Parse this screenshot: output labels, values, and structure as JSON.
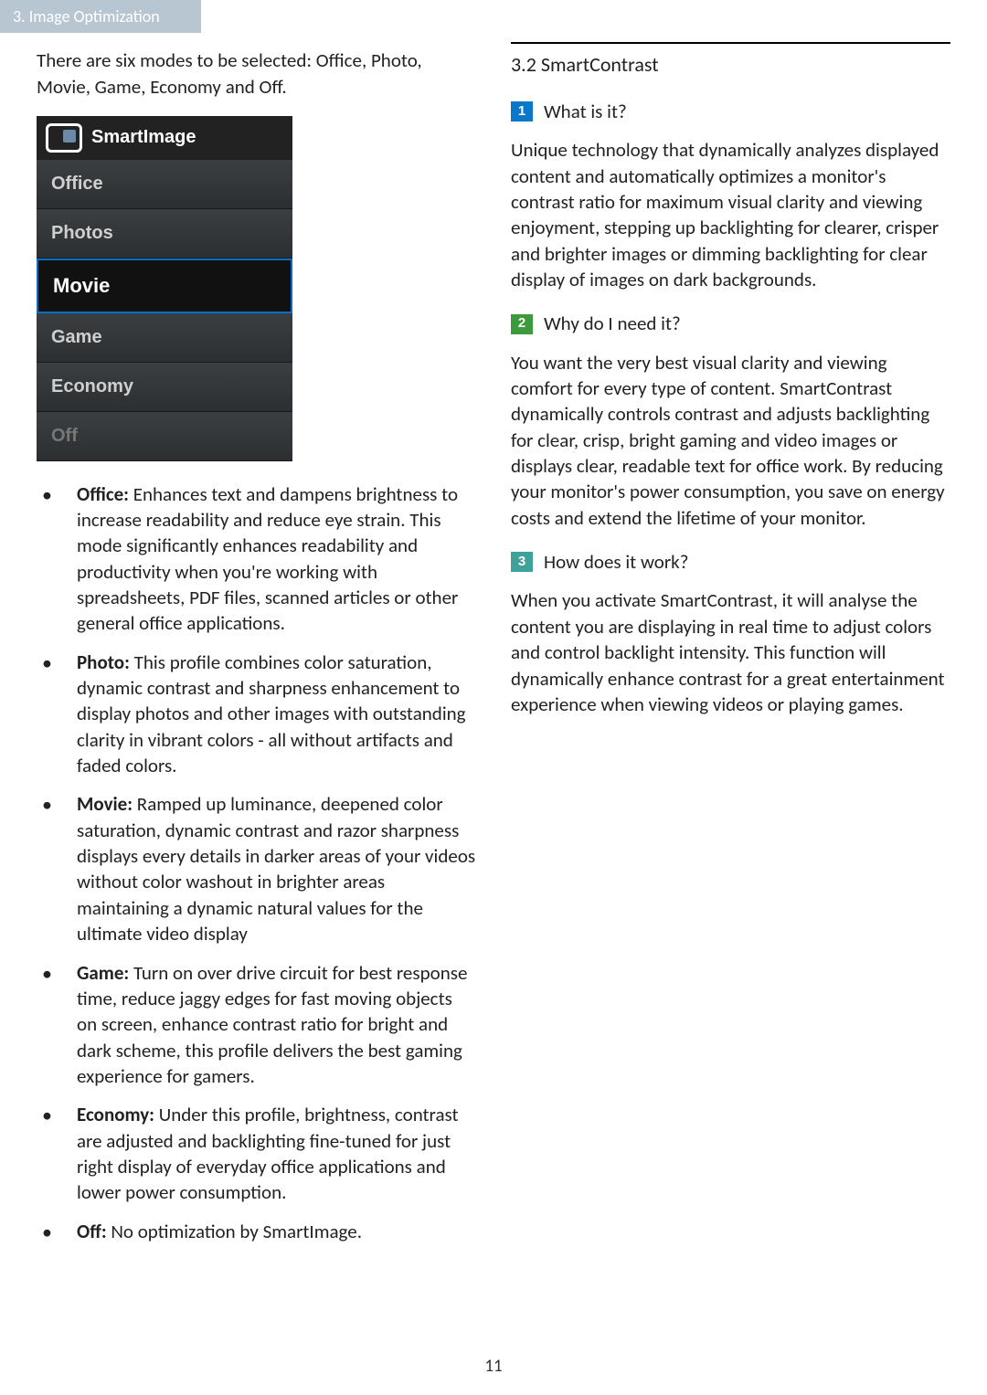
{
  "header": {
    "breadcrumb": "3. Image Optimization"
  },
  "left": {
    "intro": "There are six modes to be selected: Office, Photo, Movie, Game, Economy and Off.",
    "osd": {
      "title": "SmartImage",
      "items": [
        {
          "label": "Office",
          "selected": false,
          "dim": false
        },
        {
          "label": "Photos",
          "selected": false,
          "dim": false
        },
        {
          "label": "Movie",
          "selected": true,
          "dim": false
        },
        {
          "label": "Game",
          "selected": false,
          "dim": false
        },
        {
          "label": "Economy",
          "selected": false,
          "dim": false
        },
        {
          "label": "Off",
          "selected": false,
          "dim": true
        }
      ]
    },
    "modes": [
      {
        "term": "Office:",
        "desc": " Enhances text and dampens brightness to increase readability and reduce eye strain. This mode significantly enhances readability and productivity when you're working with spreadsheets, PDF files, scanned articles or other general office applications."
      },
      {
        "term": "Photo:",
        "desc": " This profile combines color saturation, dynamic contrast and sharpness enhancement to display photos and other images with outstanding clarity in vibrant colors - all without artifacts and faded colors."
      },
      {
        "term": "Movie:",
        "desc": " Ramped up luminance, deepened color saturation, dynamic contrast and razor sharpness displays every details in darker areas of your videos without color washout in brighter areas maintaining a dynamic natural values for the ultimate video display"
      },
      {
        "term": "Game:",
        "desc": " Turn on over drive circuit for best response time, reduce jaggy edges for fast moving objects on screen, enhance contrast ratio for bright and dark scheme, this profile delivers the best gaming experience for gamers."
      },
      {
        "term": "Economy:",
        "desc": " Under this profile, brightness, contrast are adjusted and backlighting fine-tuned for just right display of everyday office applications and lower power consumption."
      },
      {
        "term": "Off:",
        "desc": " No optimization by SmartImage."
      }
    ]
  },
  "right": {
    "section_number": "3.2",
    "section_title": "SmartContrast",
    "q1": {
      "num": "1",
      "label": "What is it?"
    },
    "p1": "Unique technology that dynamically analyzes displayed content and automatically optimizes a monitor's contrast ratio for maximum visual clarity and viewing enjoyment, stepping up backlighting for clearer, crisper and brighter images or dimming backlighting for clear display of images on dark backgrounds.",
    "q2": {
      "num": "2",
      "label": "Why do I need it?"
    },
    "p2": "You want the very best visual clarity and viewing comfort for every type of content. SmartContrast dynamically controls contrast and adjusts backlighting for clear, crisp, bright gaming and video images or displays clear, readable text for office work. By reducing your monitor's power consumption, you save on energy costs and extend the lifetime of your monitor.",
    "q3": {
      "num": "3",
      "label": "How does it work?"
    },
    "p3": "When you activate SmartContrast, it will analyse the content you are displaying in real time to adjust colors and control backlight intensity. This function will dynamically enhance contrast for a great entertainment experience when viewing videos or playing games."
  },
  "page_number": "11"
}
